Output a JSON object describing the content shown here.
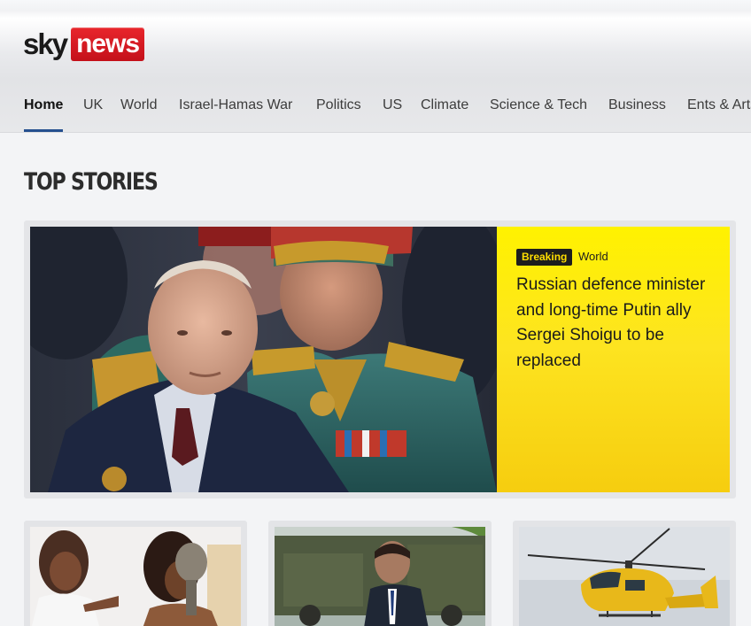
{
  "brand": {
    "logo_sky": "sky",
    "logo_news": "news",
    "logo_red": "#d9171f"
  },
  "nav": {
    "accent": "#25508f",
    "items": [
      {
        "label": "Home",
        "active": true
      },
      {
        "label": "UK"
      },
      {
        "label": "World"
      },
      {
        "label": "Israel-Hamas War"
      },
      {
        "label": "Politics"
      },
      {
        "label": "US"
      },
      {
        "label": "Climate"
      },
      {
        "label": "Science & Tech"
      },
      {
        "label": "Business"
      },
      {
        "label": "Ents & Arts"
      }
    ]
  },
  "top_stories": {
    "title": "TOP STORIES",
    "hero": {
      "badge": "Breaking",
      "category": "World",
      "headline": "Russian defence minister and long-time Putin ally Sergei Shoigu to be replaced",
      "panel_color": "#fde420"
    }
  }
}
